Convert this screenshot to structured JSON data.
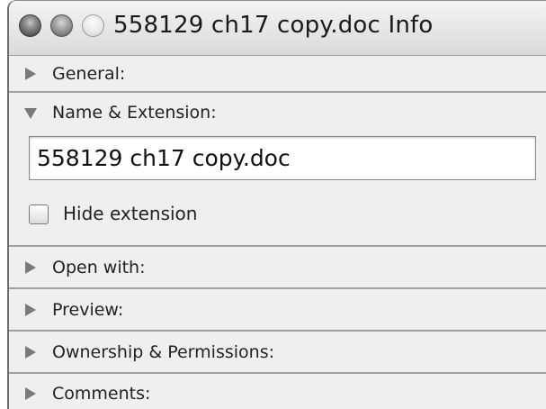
{
  "window": {
    "title": "558129 ch17 copy.doc Info"
  },
  "sections": {
    "general": {
      "label": "General:",
      "expanded": false
    },
    "name_extension": {
      "label": "Name & Extension:",
      "expanded": true,
      "filename_value": "558129 ch17 copy.doc",
      "hide_extension_label": "Hide extension",
      "hide_extension_checked": false
    },
    "open_with": {
      "label": "Open with:",
      "expanded": false
    },
    "preview": {
      "label": "Preview:",
      "expanded": false
    },
    "ownership": {
      "label": "Ownership & Permissions:",
      "expanded": false
    },
    "comments": {
      "label": "Comments:",
      "expanded": false
    }
  },
  "icons": {
    "collapsed": "triangle-right-icon",
    "expanded": "triangle-down-icon",
    "close": "close-button-icon",
    "minimize": "minimize-button-icon",
    "zoom": "zoom-button-icon"
  },
  "colors": {
    "panel_background": "#efefef",
    "divider": "#9f9f9f",
    "disclosure_triangle": "#7a7a7a"
  }
}
